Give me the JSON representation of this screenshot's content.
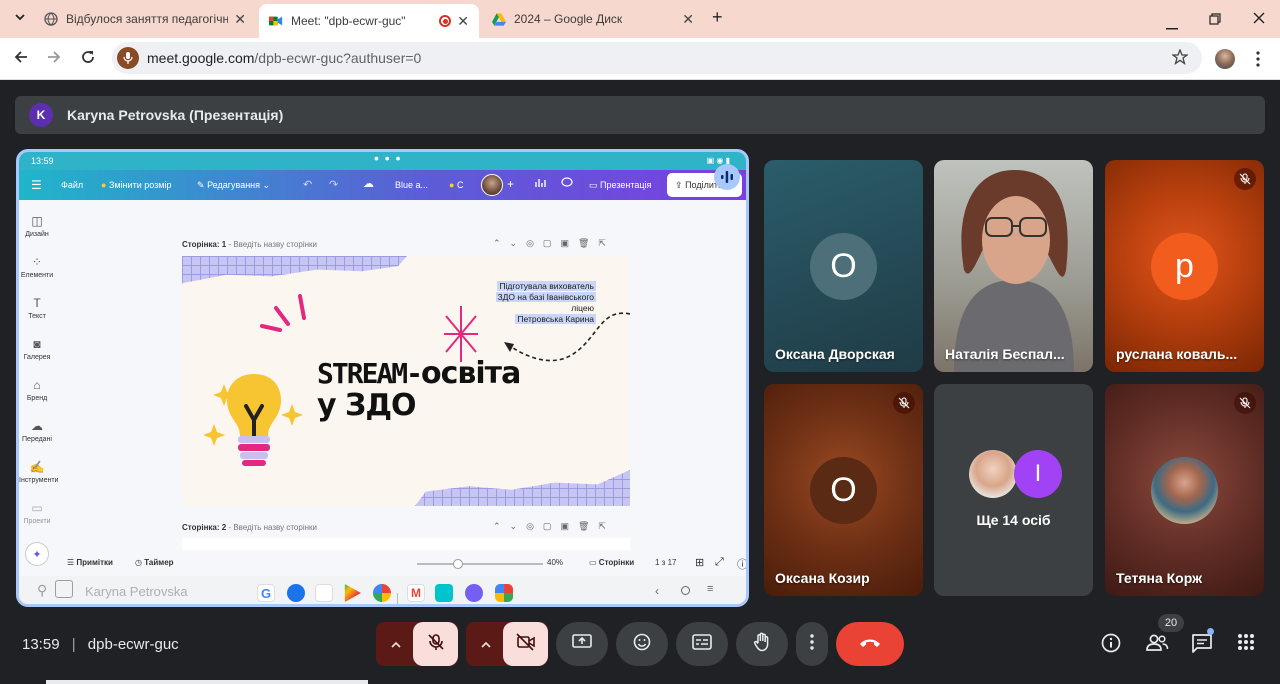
{
  "browser": {
    "tabs": [
      {
        "title": "Відбулося заняття педагогічно",
        "active": false
      },
      {
        "title": "Meet: \"dpb-ecwr-guc\"",
        "active": true
      },
      {
        "title": "2024 – Google Диск",
        "active": false
      }
    ],
    "url_host": "meet.google.com",
    "url_path": "/dpb-ecwr-guc?authuser=0",
    "new_tab": "+",
    "close": "✕"
  },
  "presenter": {
    "initial": "K",
    "label": "Karyna Petrovska (Презентація)"
  },
  "phone": {
    "time": "13:59",
    "sticky_name": "Karyna Petrovska"
  },
  "canva": {
    "menu_file": "Файл",
    "resize": "Змінити розмір",
    "editing": "Редагування",
    "theme": "Blue a...",
    "collab": "C",
    "present": "Презентація",
    "share": "Поділитися",
    "sidebar": [
      "Дизайн",
      "Елементи",
      "Текст",
      "Галерея",
      "Бренд",
      "Передані",
      "Інструменти",
      "Проекти"
    ],
    "page1_label_bold": "Сторінка: 1",
    "page1_label_rest": " - Введіть назву сторінки",
    "page2_label_bold": "Сторінка: 2",
    "page2_label_rest": " - Введіть назву сторінки",
    "notes": "Примітки",
    "timer": "Таймер",
    "zoom": "40%",
    "pages": "Сторінки",
    "page_count": "1 з 17"
  },
  "slide": {
    "title_line1_a": "STREAM-",
    "title_line1_b": "освіта",
    "title_line2": "у ЗДО",
    "credit_lines": [
      "Підготувала вихователь",
      "ЗДО на базі Іванівського",
      "ліцею",
      "Петровська Карина"
    ]
  },
  "participants": [
    {
      "name": "Оксана Дворская",
      "initial": "О",
      "muted": false
    },
    {
      "name": "Наталія Беспал...",
      "initial": "",
      "muted": false
    },
    {
      "name": "руслана коваль...",
      "initial": "р",
      "muted": true
    },
    {
      "name": "Оксана Козир",
      "initial": "О",
      "muted": true
    },
    {
      "name": "Ще 14 осіб",
      "initial": "I",
      "muted": false
    },
    {
      "name": "Тетяна Корж",
      "initial": "",
      "muted": true
    }
  ],
  "meeting": {
    "time": "13:59",
    "code": "dpb-ecwr-guc",
    "people_count": "20"
  },
  "colors": {
    "meet_bg": "#202124",
    "tile_orange": "#c2410c",
    "end_call": "#ea4335",
    "muted_red": "#f9dedc"
  }
}
